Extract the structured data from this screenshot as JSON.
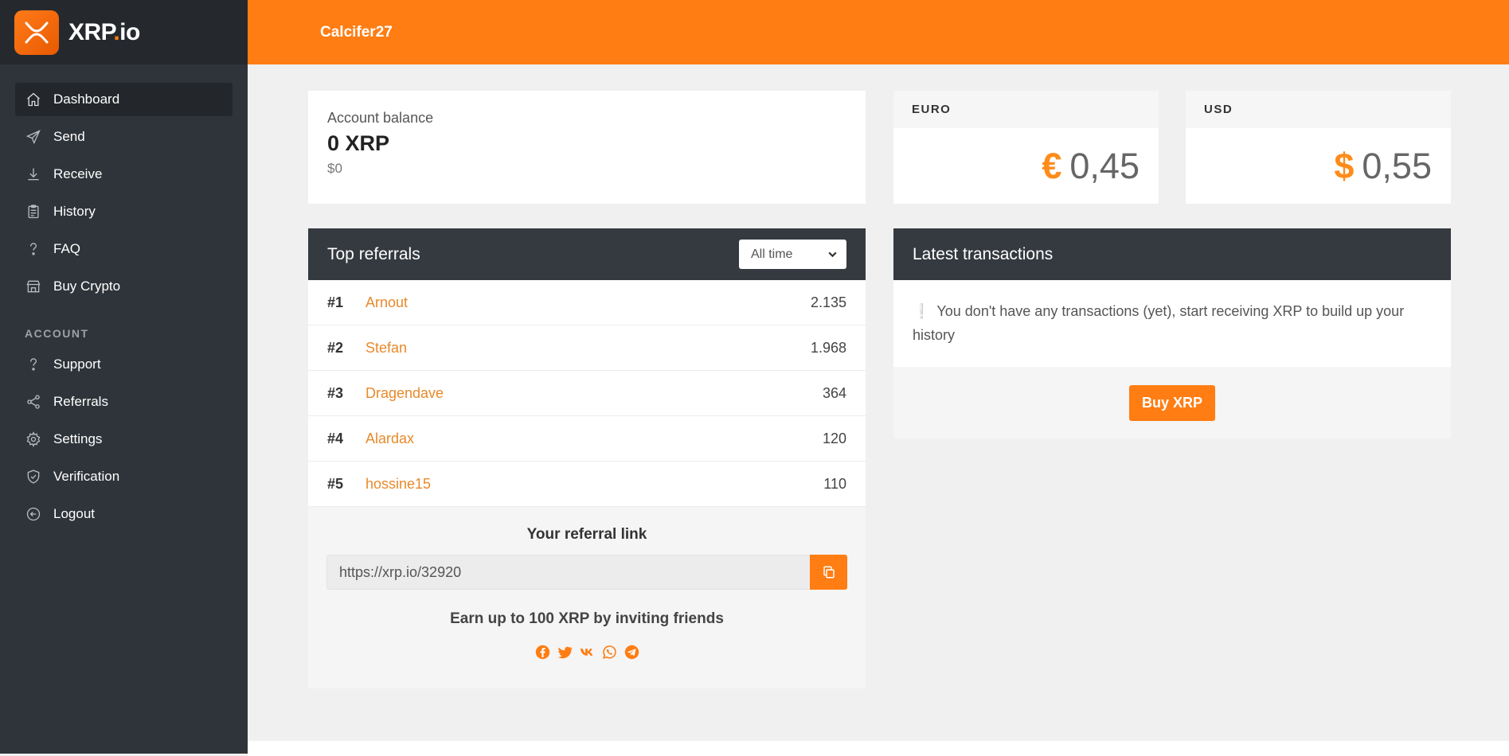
{
  "brand": {
    "name_main": "XRP",
    "name_dot": ".",
    "name_suffix": "io"
  },
  "header": {
    "username": "Calcifer27"
  },
  "sidebar": {
    "items": [
      {
        "label": "Dashboard",
        "icon": "home-icon",
        "active": true
      },
      {
        "label": "Send",
        "icon": "paper-plane-icon"
      },
      {
        "label": "Receive",
        "icon": "download-icon"
      },
      {
        "label": "History",
        "icon": "clipboard-icon"
      },
      {
        "label": "FAQ",
        "icon": "question-icon"
      },
      {
        "label": "Buy Crypto",
        "icon": "store-icon"
      }
    ],
    "section_label": "ACCOUNT",
    "account_items": [
      {
        "label": "Support",
        "icon": "question-icon"
      },
      {
        "label": "Referrals",
        "icon": "share-icon"
      },
      {
        "label": "Settings",
        "icon": "gear-icon"
      },
      {
        "label": "Verification",
        "icon": "shield-icon"
      },
      {
        "label": "Logout",
        "icon": "logout-icon"
      }
    ]
  },
  "balance": {
    "label": "Account balance",
    "value": "0 XRP",
    "fiat": "$0"
  },
  "rates": {
    "euro": {
      "label": "EURO",
      "symbol": "€",
      "value": "0,45"
    },
    "usd": {
      "label": "USD",
      "symbol": "$",
      "value": "0,55"
    }
  },
  "referrals": {
    "title": "Top referrals",
    "filter": "All time",
    "rows": [
      {
        "rank": "#1",
        "name": "Arnout",
        "count": "2.135"
      },
      {
        "rank": "#2",
        "name": "Stefan",
        "count": "1.968"
      },
      {
        "rank": "#3",
        "name": "Dragendave",
        "count": "364"
      },
      {
        "rank": "#4",
        "name": "Alardax",
        "count": "120"
      },
      {
        "rank": "#5",
        "name": "hossine15",
        "count": "110"
      }
    ],
    "link_title": "Your referral link",
    "link": "https://xrp.io/32920",
    "earn_text": "Earn up to 100 XRP by inviting friends",
    "social_icons": [
      "facebook-icon",
      "twitter-icon",
      "vk-icon",
      "whatsapp-icon",
      "telegram-icon"
    ]
  },
  "transactions": {
    "title": "Latest transactions",
    "empty_mark": "❕",
    "empty_text": "You don't have any transactions (yet), start receiving XRP to build up your history",
    "buy_label": "Buy XRP"
  },
  "colors": {
    "accent": "#ff7d13",
    "sidebar": "#2f343a",
    "panel_head": "#353a40"
  }
}
